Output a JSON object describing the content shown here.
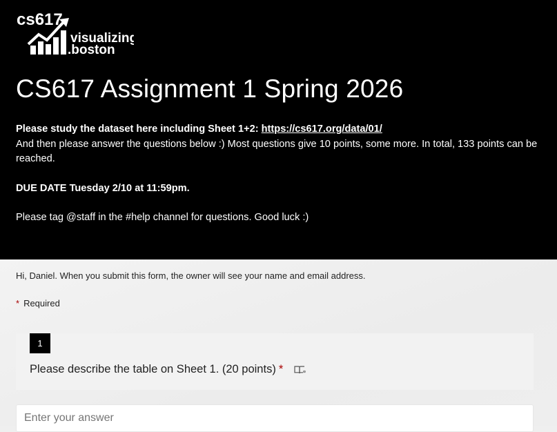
{
  "header": {
    "logo": {
      "line1": "cs617",
      "line2": "visualizing",
      "line3": ".boston"
    },
    "title": "CS617 Assignment 1 Spring 2026",
    "intro_bold_prefix": "Please study the dataset here including Sheet 1+2: ",
    "dataset_link": "https://cs617.org/data/01/",
    "intro_line2": "And then please answer the questions below :) Most questions give 10 points, some more. In total, 133 points can be reached.",
    "due_date": "DUE DATE Tuesday 2/10 at 11:59pm.",
    "help_text": "Please tag @staff in the #help channel for questions. Good luck :)"
  },
  "form": {
    "greeting": "Hi, Daniel. When you submit this form, the owner will see your name and email address.",
    "required_star": "*",
    "required_label": "Required",
    "questions": [
      {
        "number": "1",
        "text": "Please describe the table on Sheet 1. (20 points)",
        "required_star": "*",
        "placeholder": "Enter your answer"
      }
    ]
  },
  "colors": {
    "header_bg": "#000000",
    "required": "#a80000",
    "page_bg": "#efefef"
  },
  "icons": {
    "reader": "immersive-reader-icon",
    "logo_chart": "bar-chart-arrow-icon"
  }
}
